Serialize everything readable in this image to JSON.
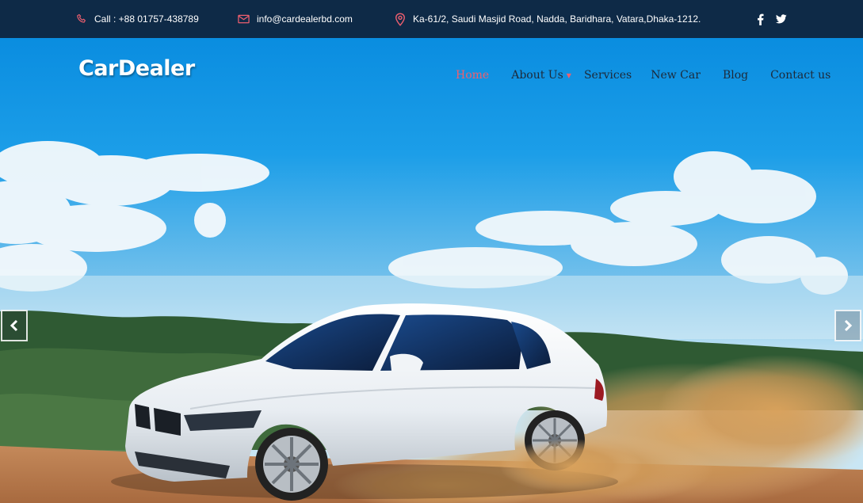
{
  "topbar": {
    "phone": "Call : +88 01757-438789",
    "email": "info@cardealerbd.com",
    "address": "Ka-61/2, Saudi Masjid Road, Nadda, Baridhara, Vatara,Dhaka-1212.",
    "icons": {
      "phone": "phone-icon",
      "email": "envelope-icon",
      "address": "map-pin-icon",
      "facebook": "facebook-icon",
      "twitter": "twitter-icon"
    }
  },
  "header": {
    "logo": "CarDealer"
  },
  "nav": {
    "items": [
      {
        "label": "Home",
        "active": true
      },
      {
        "label": "About Us",
        "has_dropdown": true
      },
      {
        "label": "Services"
      },
      {
        "label": "New Car"
      },
      {
        "label": "Blog"
      },
      {
        "label": "Contact us"
      }
    ]
  },
  "slider": {
    "prev_icon": "chevron-left-icon",
    "next_icon": "chevron-right-icon"
  },
  "colors": {
    "topbar_bg": "#0e2a47",
    "accent": "#ef5f6f",
    "nav_text": "#1d2a3a",
    "sky_top": "#0a8de0",
    "sand": "#d9a25c"
  }
}
